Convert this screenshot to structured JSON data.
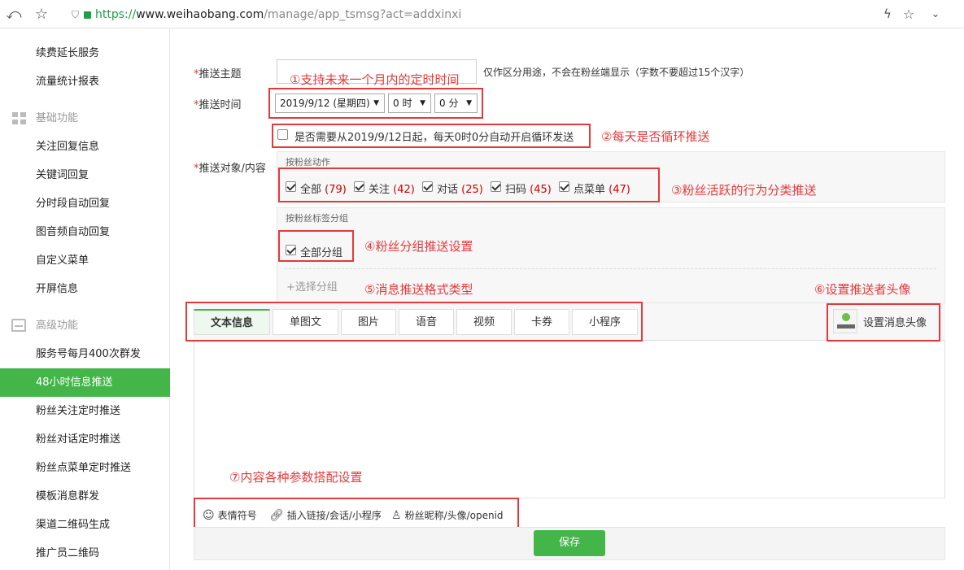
{
  "browser": {
    "back_icon": "undo-arrow-icon",
    "star_icon": "star-outline-icon",
    "url_scheme": "https://",
    "url_host": "www.weihaobang.com",
    "url_path": "/manage/app_tsmsg?act=addxinxi",
    "right_icons": [
      "lightning-icon",
      "star-icon",
      "chevron-down-icon"
    ]
  },
  "sidebar": {
    "items_top": [
      "续费延长服务",
      "流量统计报表"
    ],
    "group_basic": "基础功能",
    "items_basic": [
      "关注回复信息",
      "关键词回复",
      "分时段自动回复",
      "图音频自动回复",
      "自定义菜单",
      "开屏信息"
    ],
    "group_advanced": "高级功能",
    "items_advanced": [
      "服务号每月400次群发",
      "48小时信息推送",
      "粉丝关注定时推送",
      "粉丝对话定时推送",
      "粉丝点菜单定时推送",
      "模板消息群发",
      "渠道二维码生成",
      "推广员二维码"
    ],
    "active_index": 1,
    "accent_color": "#44b549"
  },
  "form": {
    "required_mark": "*",
    "subject_label": "推送主题",
    "subject_value": "",
    "subject_hint": "仅作区分用途，不会在粉丝端显示（字数不要超过15个汉字）",
    "time_label": "推送时间",
    "date_select": "2019/9/12 (星期四)",
    "hour_select": "0 时",
    "minute_select": "0 分",
    "loop_checkbox": "是否需要从2019/9/12日起，每天0时0分自动开启循环发送",
    "loop_checked": false,
    "target_label": "推送对象/内容",
    "action_panel_title": "按粉丝动作",
    "actions": [
      {
        "label": "全部",
        "count": "(79)",
        "checked": true
      },
      {
        "label": "关注",
        "count": "(42)",
        "checked": true
      },
      {
        "label": "对话",
        "count": "(25)",
        "checked": true
      },
      {
        "label": "扫码",
        "count": "(45)",
        "checked": true
      },
      {
        "label": "点菜单",
        "count": "(47)",
        "checked": true
      }
    ],
    "tag_panel_title": "按粉丝标签分组",
    "all_groups": "全部分组",
    "all_groups_checked": true,
    "select_group": "+选择分组"
  },
  "editor": {
    "tabs": [
      "文本信息",
      "单图文",
      "图片",
      "语音",
      "视频",
      "卡券",
      "小程序"
    ],
    "active_tab": 0,
    "avatar_button": "设置消息头像",
    "tools": [
      {
        "icon": "smiley-icon",
        "label": "表情符号"
      },
      {
        "icon": "link-icon",
        "label": "插入链接/会话/小程序"
      },
      {
        "icon": "user-icon",
        "label": "粉丝昵称/头像/openid"
      }
    ],
    "save": "保存"
  },
  "annotations": {
    "a1": "①支持未来一个月内的定时时间",
    "a2": "②每天是否循环推送",
    "a3": "③粉丝活跃的行为分类推送",
    "a4": "④粉丝分组推送设置",
    "a5": "⑤消息推送格式类型",
    "a6": "⑥设置推送者头像",
    "a7": "⑦内容各种参数搭配设置",
    "color": "#e4393c"
  }
}
